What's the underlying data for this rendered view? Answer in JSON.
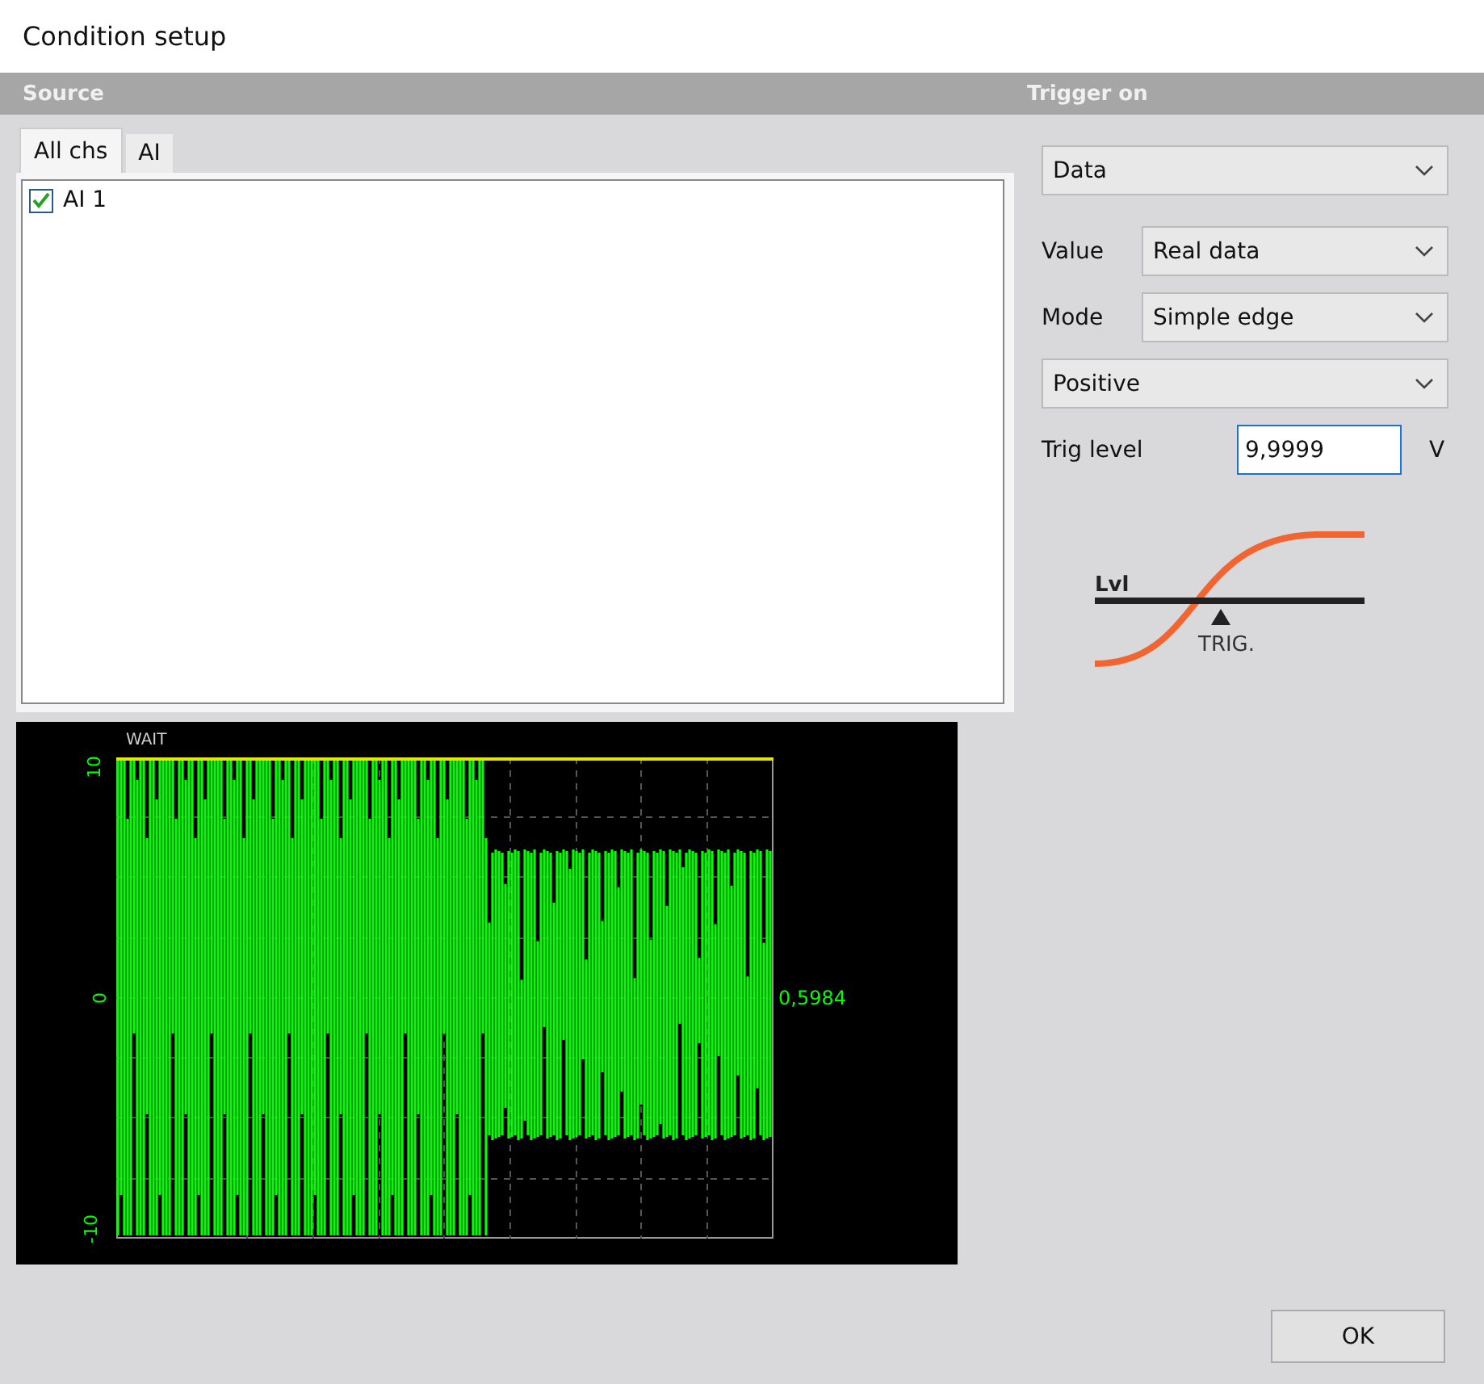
{
  "window": {
    "title": "Condition setup"
  },
  "source": {
    "header": "Source",
    "tabs": [
      {
        "label": "All chs",
        "selected": true
      },
      {
        "label": "AI",
        "selected": false
      }
    ],
    "channels": [
      {
        "label": "AI 1",
        "checked": true
      }
    ],
    "scope": {
      "status": "WAIT",
      "y_labels": [
        "10",
        "0",
        "-10"
      ],
      "reading": "0,5984"
    }
  },
  "trigger": {
    "header": "Trigger on",
    "fields": [
      {
        "kind": "dropdown",
        "value": "Data"
      },
      {
        "kind": "labeled-dropdown",
        "label": "Value",
        "value": "Real data"
      },
      {
        "kind": "labeled-dropdown",
        "label": "Mode",
        "value": "Simple edge"
      },
      {
        "kind": "dropdown",
        "value": "Positive"
      },
      {
        "kind": "input",
        "label": "Trig level",
        "value": "9,9999",
        "unit": "V"
      }
    ],
    "diagram": {
      "level_label": "Lvl",
      "trigger_label": "TRIG."
    }
  },
  "buttons": [
    "OK"
  ]
}
